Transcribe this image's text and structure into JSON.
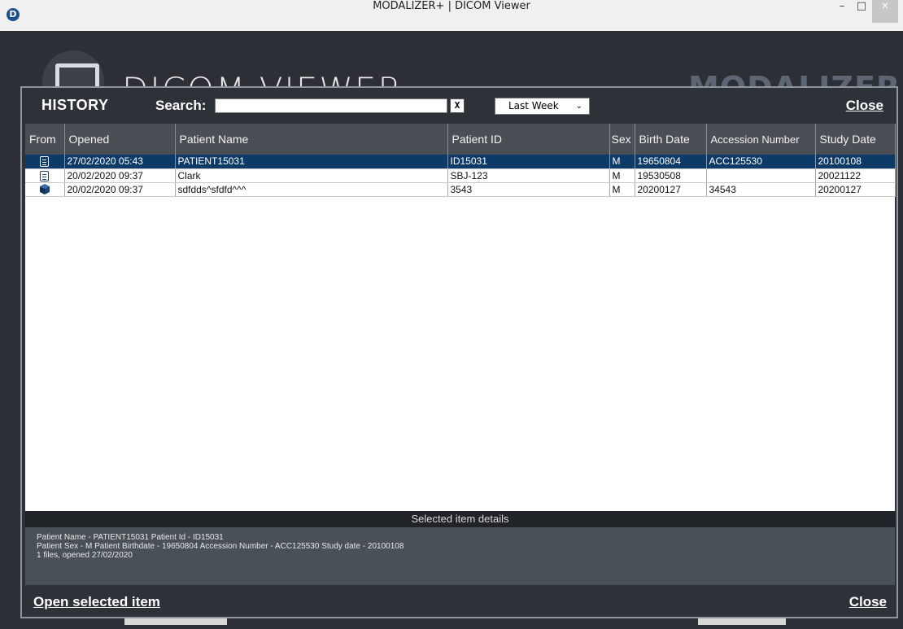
{
  "window": {
    "title": "MODALIZER+ | DICOM Viewer",
    "minimize": "–",
    "maximize": "□",
    "close": "×",
    "app_icon": "D"
  },
  "background": {
    "title": "DICOM VIEWER",
    "brand": "MODALIZER+"
  },
  "history": {
    "title": "HISTORY",
    "search_label": "Search:",
    "search_value": "",
    "clear_button": "X",
    "period": "Last Week",
    "close_label": "Close",
    "columns": [
      "From",
      "Opened",
      "Patient Name",
      "Patient ID",
      "Sex",
      "Birth Date",
      "Accession Number",
      "Study Date"
    ],
    "rows": [
      {
        "from_icon": "document-icon",
        "opened": "27/02/2020 05:43",
        "patient_name": "PATIENT15031",
        "patient_id": "ID15031",
        "sex": "M",
        "birth_date": "19650804",
        "accession": "ACC125530",
        "study_date": "20100108",
        "selected": true
      },
      {
        "from_icon": "document-icon",
        "opened": "20/02/2020 09:37",
        "patient_name": "Clark",
        "patient_id": "SBJ-123",
        "sex": "M",
        "birth_date": "19530508",
        "accession": "",
        "study_date": "20021122",
        "selected": false
      },
      {
        "from_icon": "cube-icon",
        "opened": "20/02/2020 09:37",
        "patient_name": "sdfdds^sfdfd^^^",
        "patient_id": "3543",
        "sex": "M",
        "birth_date": "20200127",
        "accession": "34543",
        "study_date": "20200127",
        "selected": false
      }
    ]
  },
  "details": {
    "header": "Selected item details",
    "line1": "Patient Name - PATIENT15031   Patient Id - ID15031",
    "line2": "Patient Sex - M   Patient Birthdate - 19650804   Accession Number - ACC125530   Study date - 20100108",
    "line3": "1 files, opened 27/02/2020"
  },
  "footer": {
    "open_selected": "Open selected item",
    "close_label": "Close"
  },
  "colors": {
    "selected_row": "#0e3a68",
    "panel": "#2d3238",
    "header_row": "#4a4f56"
  }
}
